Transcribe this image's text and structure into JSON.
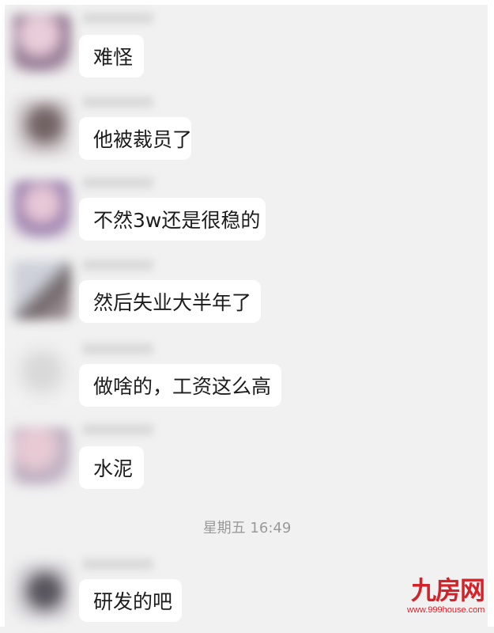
{
  "messages": [
    {
      "text": "难怪",
      "avatar_colors": [
        "#e8c7d6",
        "#7a5a7a"
      ]
    },
    {
      "text": "他被裁员了",
      "avatar_colors": [
        "#c9c0c4",
        "#5c4a4c"
      ]
    },
    {
      "text": "不然3w还是很稳的",
      "avatar_colors": [
        "#e6c1d3",
        "#8a6aa0"
      ]
    },
    {
      "text": "然后失业大半年了",
      "avatar_colors": [
        "#c8ccd6",
        "#5a4e52"
      ]
    },
    {
      "text": "做啥的，工资这么高",
      "avatar_colors": [
        "#e8e8e8",
        "#d4d4d4"
      ]
    },
    {
      "text": "水泥",
      "avatar_colors": [
        "#e6c4cf",
        "#b0a0b6"
      ]
    },
    {
      "text": "研发的吧",
      "avatar_colors": [
        "#c2bfc6",
        "#3e3a44"
      ]
    }
  ],
  "timestamp": "星期五 16:49",
  "watermark": {
    "logo": "九房网",
    "url": "www.999house.com",
    "color": "#d2232a"
  },
  "colors": {
    "background": "#f1f1f1",
    "bubble": "#ffffff",
    "text": "#1c1c1c",
    "timestamp": "#9a9a9a"
  }
}
